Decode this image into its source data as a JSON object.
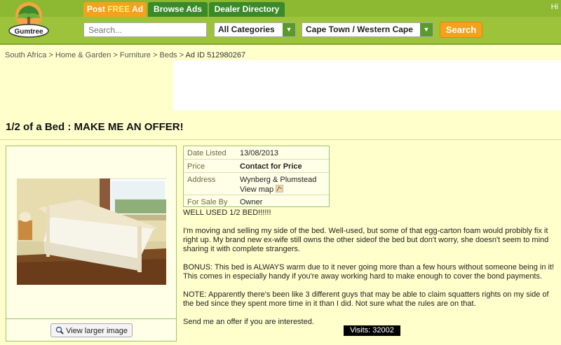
{
  "header": {
    "logo_text": "Gumtree",
    "tabs": [
      {
        "label_a": "Post ",
        "label_b": "FREE",
        "label_c": " Ad"
      },
      {
        "label": "Browse Ads"
      },
      {
        "label": "Dealer Directory"
      }
    ],
    "greeting": "Hi",
    "search_placeholder": "Search...",
    "category": "All Categories",
    "location": "Cape Town / Western Cape",
    "search_button": "Search"
  },
  "breadcrumb": [
    "South Africa",
    "Home & Garden",
    "Furniture",
    "Beds",
    "Ad ID 512980267"
  ],
  "ad": {
    "title": "1/2 of a Bed : MAKE ME AN OFFER!",
    "view_larger": "View larger image",
    "details": [
      {
        "label": "Date Listed",
        "value": "13/08/2013"
      },
      {
        "label": "Price",
        "value": "Contact for Price"
      },
      {
        "label": "Address",
        "value": "Wynberg & Plumstead",
        "value2": "View map"
      },
      {
        "label": "For Sale By",
        "value": "Owner"
      }
    ],
    "description": [
      "WELL USED 1/2 BED!!!!!!",
      "I'm moving and selling my side of the bed. Well-used, but some of that egg-carton foam would probibly fix it right up. My brand new ex-wife still owns the other sideof the bed but don't worry, she doesn't seem to mind sharing it with complete strangers.",
      "BONUS: This bed is ALWAYS warm due to it never going more than a few hours without someone being in it! This comes in especially handy if you're away working hard to make enough to cover the bond payments.",
      "NOTE: Apparently there's been like 3 different guys that may be able to claim squatters rights on my side of the bed since they spent more time in it than I did. Not sure what the rules are on that.",
      "Send me an offer if you are interested."
    ],
    "visits": "Visits: 32002"
  },
  "colors": {
    "header_green": "#9dc33a",
    "accent_orange": "#f4a21c",
    "tab_green": "#3a8a2a",
    "page_bg": "#ffffcc"
  }
}
